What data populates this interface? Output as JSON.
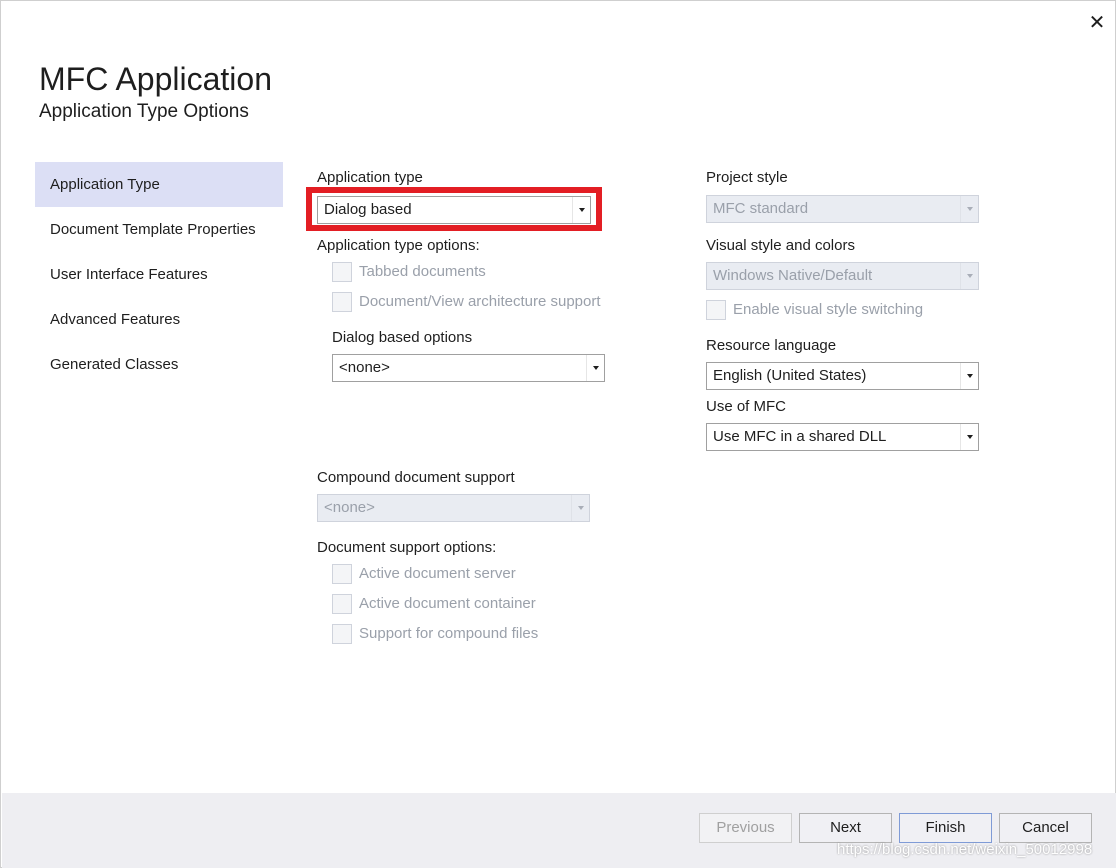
{
  "window": {
    "title": "MFC Application",
    "subtitle": "Application Type Options",
    "close_glyph": "✕"
  },
  "sidebar": {
    "items": [
      {
        "label": "Application Type"
      },
      {
        "label": "Document Template Properties"
      },
      {
        "label": "User Interface Features"
      },
      {
        "label": "Advanced Features"
      },
      {
        "label": "Generated Classes"
      }
    ]
  },
  "app_type": {
    "label": "Application type",
    "value": "Dialog based",
    "options_label": "Application type options:",
    "options": [
      {
        "label": "Tabbed documents"
      },
      {
        "label": "Document/View architecture support"
      }
    ],
    "dialog_options_label": "Dialog based options",
    "dialog_options_value": "<none>"
  },
  "compound": {
    "label": "Compound document support",
    "value": "<none>",
    "doc_support_label": "Document support options:",
    "options": [
      {
        "label": "Active document server"
      },
      {
        "label": "Active document container"
      },
      {
        "label": "Support for compound files"
      }
    ]
  },
  "right": {
    "project_style_label": "Project style",
    "project_style_value": "MFC standard",
    "visual_style_label": "Visual style and colors",
    "visual_style_value": "Windows Native/Default",
    "enable_switching_label": "Enable visual style switching",
    "resource_language_label": "Resource language",
    "resource_language_value": "English (United States)",
    "use_mfc_label": "Use of MFC",
    "use_mfc_value": "Use MFC in a shared DLL"
  },
  "buttons": {
    "previous": "Previous",
    "next": "Next",
    "finish": "Finish",
    "cancel": "Cancel"
  },
  "watermark": "https://blog.csdn.net/weixin_50012998",
  "colors": {
    "highlight": "#e31e24",
    "selected_nav": "#dcdff5"
  }
}
